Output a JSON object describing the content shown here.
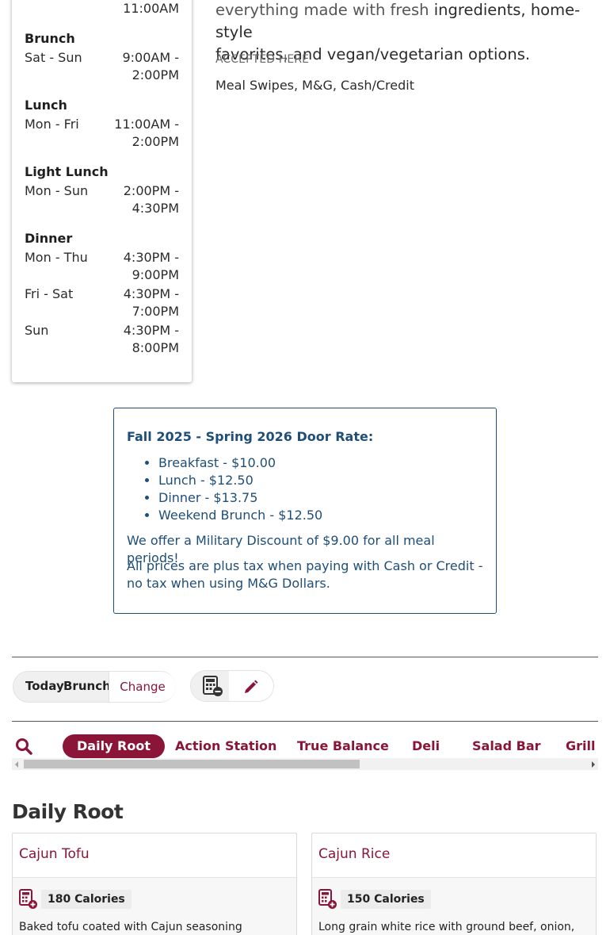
{
  "hours": {
    "top_time": "11:00AM",
    "periods": [
      {
        "name": "Brunch",
        "rows": [
          {
            "days": "Sat - Sun",
            "time1": "9:00AM -",
            "time2": "2:00PM"
          }
        ]
      },
      {
        "name": "Lunch",
        "rows": [
          {
            "days": "Mon - Fri",
            "time1": "11:00AM -",
            "time2": "2:00PM"
          }
        ]
      },
      {
        "name": "Light Lunch",
        "rows": [
          {
            "days": "Mon - Sun",
            "time1": "2:00PM -",
            "time2": "4:30PM"
          }
        ]
      },
      {
        "name": "Dinner",
        "rows": [
          {
            "days": "Mon - Thu",
            "time1": "4:30PM -",
            "time2": "9:00PM"
          },
          {
            "days": "Fri - Sat",
            "time1": "4:30PM -",
            "time2": "7:00PM"
          },
          {
            "days": "Sun",
            "time1": "4:30PM -",
            "time2": "8:00PM"
          }
        ]
      }
    ]
  },
  "description": {
    "line1_faded": "everything made with fresh",
    "line1_rest": "ingredients, home-style",
    "line2": "favorites, and vegan/vegetarian options."
  },
  "accepted": {
    "label": "ACCEPTED HERE",
    "value": "Meal Swipes, M&G, Cash/Credit"
  },
  "door_rate": {
    "title": "Fall 2025 - Spring 2026 Door Rate:",
    "items": [
      "Breakfast - $10.00",
      "Lunch - $12.50",
      "Dinner - $13.75",
      "Weekend Brunch - $12.50"
    ],
    "note1": "We offer a Military Discount of $9.00 for all meal periods!",
    "note2": "All prices are plus tax when paying with Cash or Credit - no tax when using M&G Dollars."
  },
  "selector": {
    "date": "Today",
    "meal": "Brunch",
    "change_label": "Change"
  },
  "tools": {
    "left_icon": "nutrition-calculator-icon",
    "right_icon": "pencil-icon"
  },
  "stations": {
    "search_icon": "search-icon",
    "tabs": [
      "Daily Root",
      "Action Station",
      "True Balance",
      "Deli",
      "Salad Bar",
      "Grill"
    ],
    "active": "Daily Root"
  },
  "section": {
    "title": "Daily Root"
  },
  "items": [
    {
      "name": "Cajun Tofu",
      "calories": "180 Calories",
      "desc": "Baked tofu coated with Cajun seasoning"
    },
    {
      "name": "Cajun Rice",
      "calories": "150 Calories",
      "desc": "Long grain white rice with ground beef, onion,"
    }
  ],
  "colors": {
    "brand": "#8a1538",
    "rate_text": "#1f4e78"
  }
}
